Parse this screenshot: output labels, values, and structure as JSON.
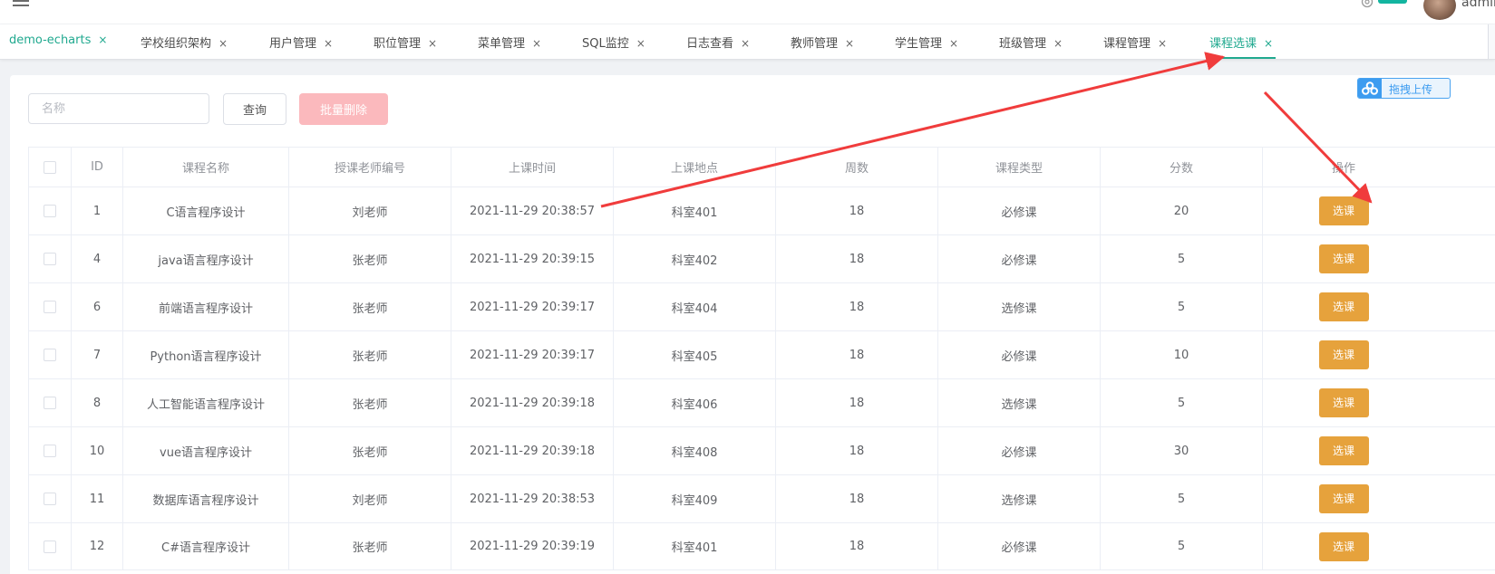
{
  "header": {
    "user_name": "admin"
  },
  "tabs": [
    {
      "label": "demo-echarts",
      "close": "×",
      "active": false
    },
    {
      "label": "学校组织架构",
      "close": "×",
      "active": false
    },
    {
      "label": "用户管理",
      "close": "×",
      "active": false
    },
    {
      "label": "职位管理",
      "close": "×",
      "active": false
    },
    {
      "label": "菜单管理",
      "close": "×",
      "active": false
    },
    {
      "label": "SQL监控",
      "close": "×",
      "active": false
    },
    {
      "label": "日志查看",
      "close": "×",
      "active": false
    },
    {
      "label": "教师管理",
      "close": "×",
      "active": false
    },
    {
      "label": "学生管理",
      "close": "×",
      "active": false
    },
    {
      "label": "班级管理",
      "close": "×",
      "active": false
    },
    {
      "label": "课程管理",
      "close": "×",
      "active": false
    },
    {
      "label": "课程选课",
      "close": "×",
      "active": true
    }
  ],
  "toolbar": {
    "search_placeholder": "名称",
    "search_value": "",
    "query_label": "查询",
    "batch_delete_label": "批量删除",
    "upload_label": "拖拽上传"
  },
  "table": {
    "columns": [
      "",
      "ID",
      "课程名称",
      "授课老师编号",
      "上课时间",
      "上课地点",
      "周数",
      "课程类型",
      "分数",
      "操作"
    ],
    "action_label": "选课",
    "rows": [
      {
        "id": "1",
        "name": "C语言程序设计",
        "teacher": "刘老师",
        "time": "2021-11-29 20:38:57",
        "place": "科室401",
        "weeks": "18",
        "type": "必修课",
        "score": "20"
      },
      {
        "id": "4",
        "name": "java语言程序设计",
        "teacher": "张老师",
        "time": "2021-11-29 20:39:15",
        "place": "科室402",
        "weeks": "18",
        "type": "必修课",
        "score": "5"
      },
      {
        "id": "6",
        "name": "前端语言程序设计",
        "teacher": "张老师",
        "time": "2021-11-29 20:39:17",
        "place": "科室404",
        "weeks": "18",
        "type": "选修课",
        "score": "5"
      },
      {
        "id": "7",
        "name": "Python语言程序设计",
        "teacher": "张老师",
        "time": "2021-11-29 20:39:17",
        "place": "科室405",
        "weeks": "18",
        "type": "必修课",
        "score": "10"
      },
      {
        "id": "8",
        "name": "人工智能语言程序设计",
        "teacher": "张老师",
        "time": "2021-11-29 20:39:18",
        "place": "科室406",
        "weeks": "18",
        "type": "选修课",
        "score": "5"
      },
      {
        "id": "10",
        "name": "vue语言程序设计",
        "teacher": "张老师",
        "time": "2021-11-29 20:39:18",
        "place": "科室408",
        "weeks": "18",
        "type": "必修课",
        "score": "30"
      },
      {
        "id": "11",
        "name": "数据库语言程序设计",
        "teacher": "刘老师",
        "time": "2021-11-29 20:38:53",
        "place": "科室409",
        "weeks": "18",
        "type": "选修课",
        "score": "5"
      },
      {
        "id": "12",
        "name": "C#语言程序设计",
        "teacher": "张老师",
        "time": "2021-11-29 20:39:19",
        "place": "科室401",
        "weeks": "18",
        "type": "必修课",
        "score": "5"
      }
    ]
  },
  "colors": {
    "accent": "#20a98f",
    "warning": "#e6a23c",
    "danger_disabled": "#fbb9bd",
    "annotation_arrow": "#f03c3c",
    "upload_blue": "#3d9cf0"
  },
  "icons": {
    "menu": "hamburger-icon",
    "settings": "gear-icon",
    "tab_close": "close-icon",
    "upload": "cloud-upload-icon"
  }
}
